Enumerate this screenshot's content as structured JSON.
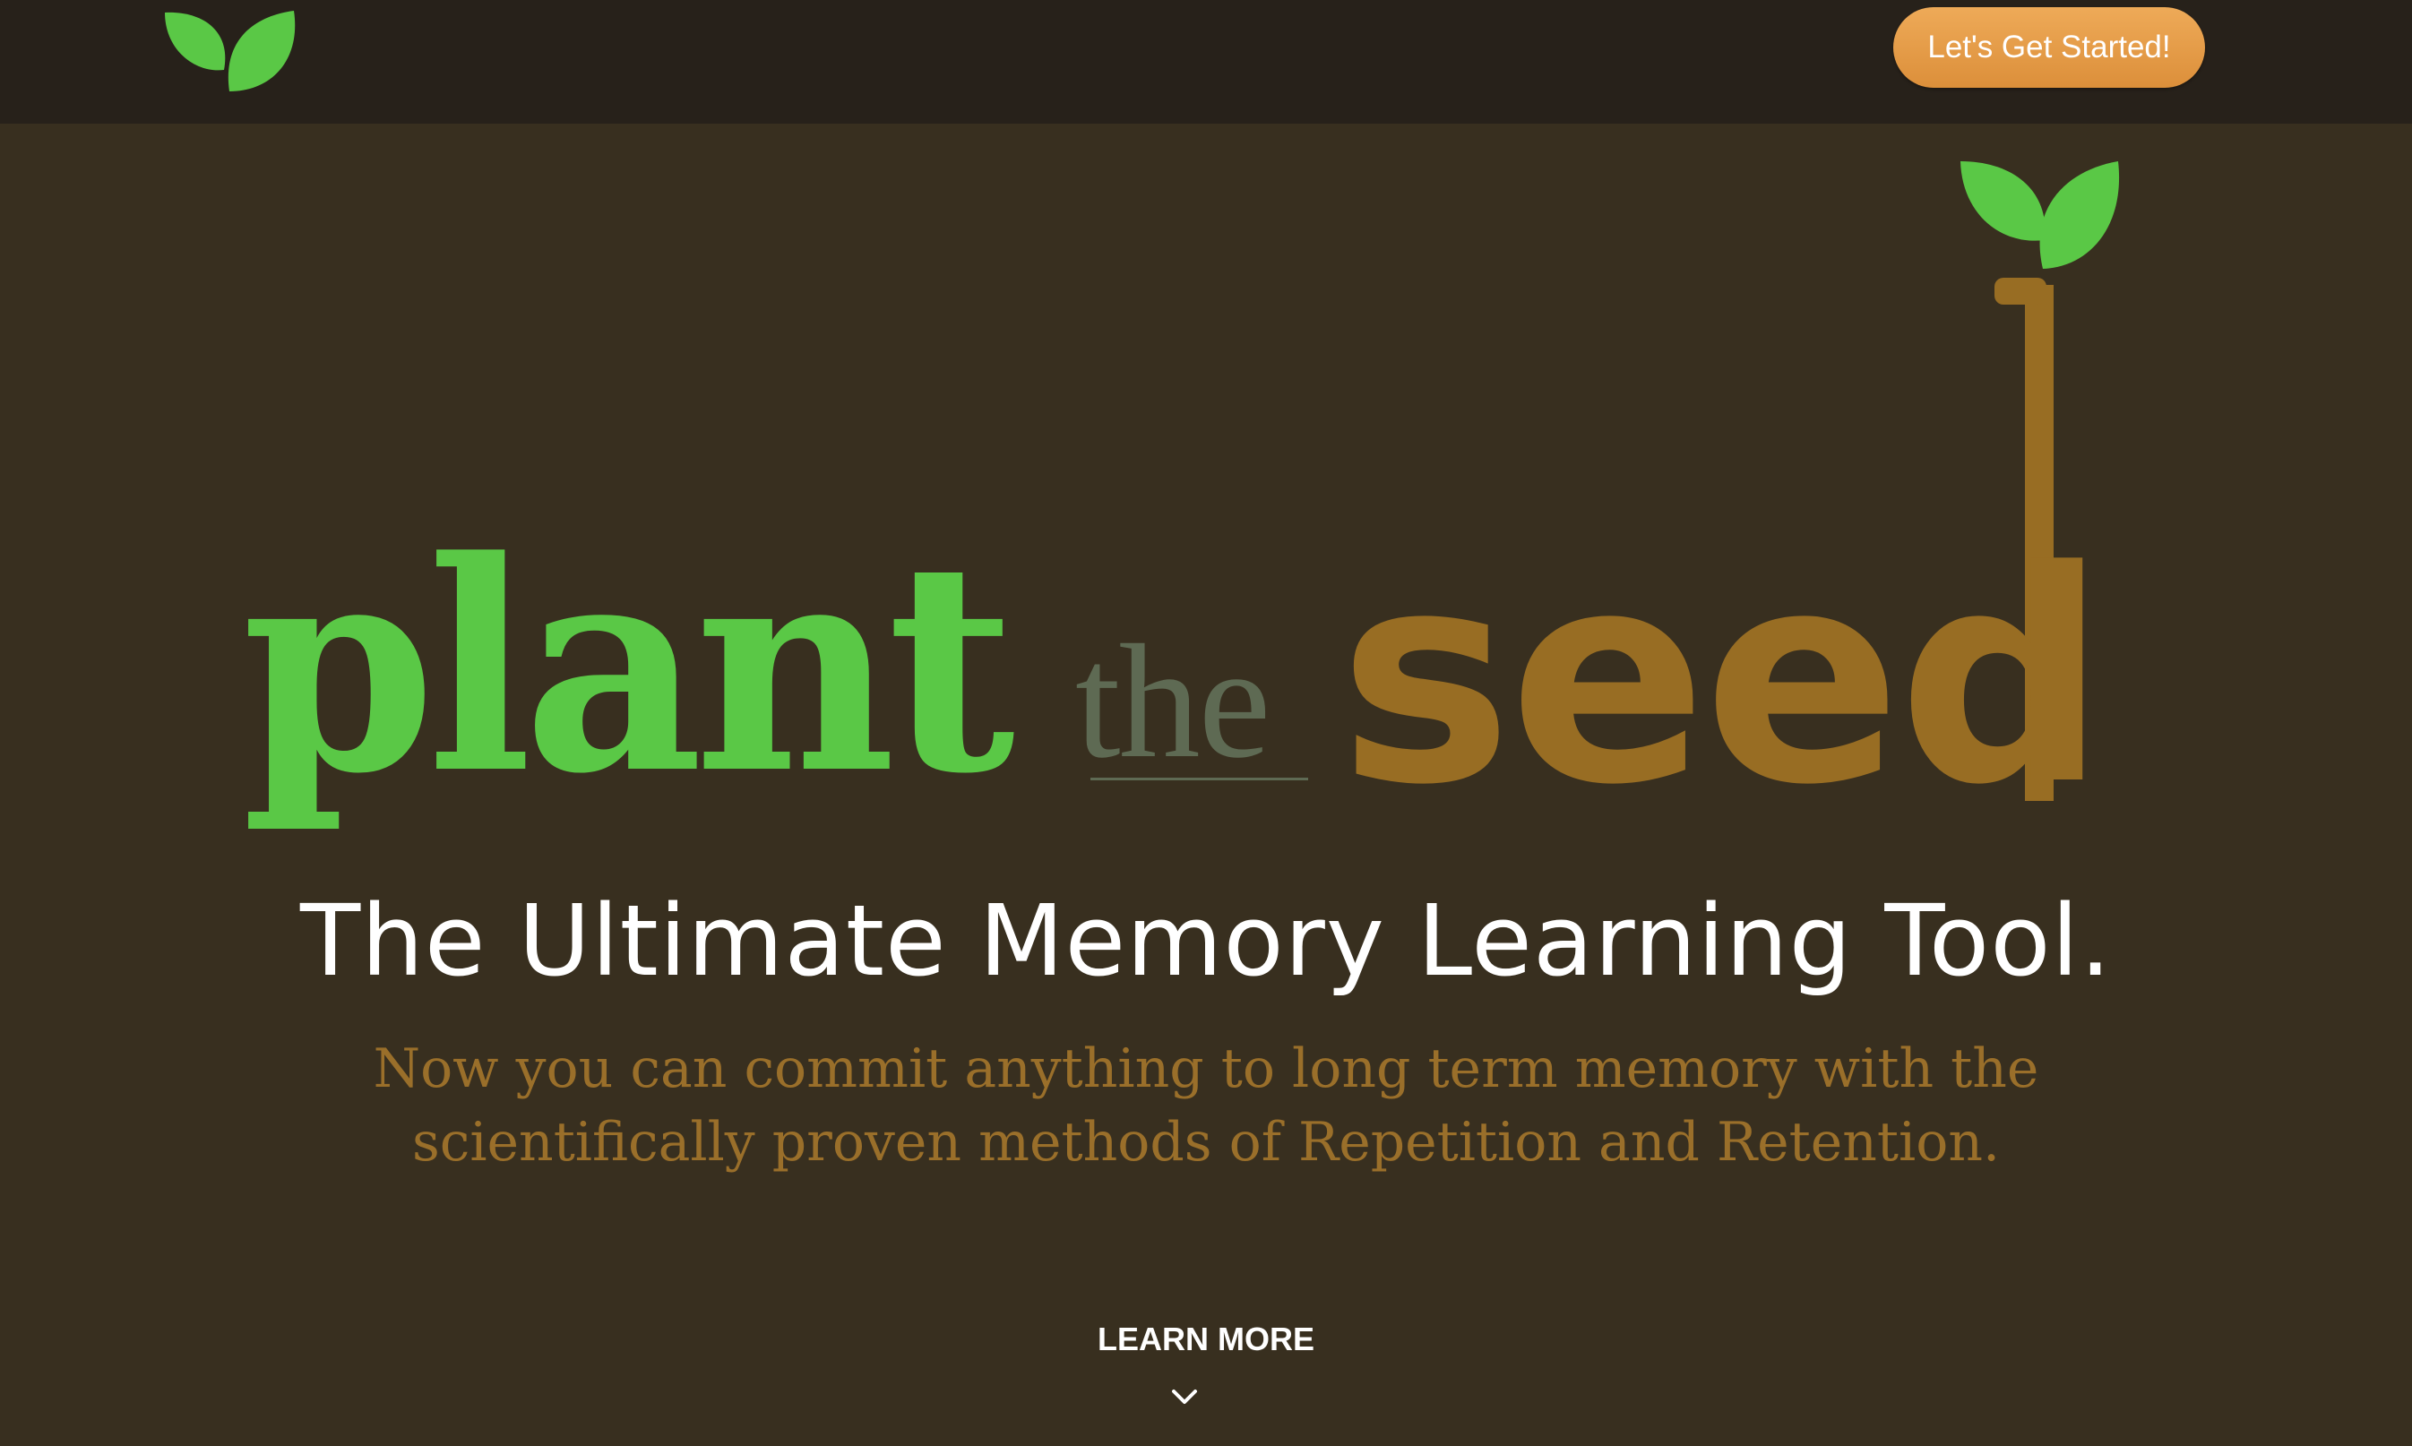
{
  "header": {
    "logo_icon": "sprout-leaves-icon",
    "cta_label": "Let's Get Started!"
  },
  "hero": {
    "logo": {
      "word_plant": "plant",
      "word_the": "the",
      "word_seed": "seed",
      "icon": "sprout-leaves-icon"
    },
    "tagline": "The Ultimate Memory Learning Tool.",
    "description": "Now you can commit anything to long term memory with the scientifically proven methods of Repetition and Retention.",
    "learn_more_label": "LEARN MORE",
    "learn_more_icon": "chevron-down-icon"
  },
  "colors": {
    "navbar_bg": "#27211a",
    "page_bg": "#382f1f",
    "leaf_green": "#5ac846",
    "seed_brown": "#986d23",
    "the_gray_green": "#5e6a53",
    "cta_orange": "#e59b45",
    "white": "#ffffff"
  }
}
